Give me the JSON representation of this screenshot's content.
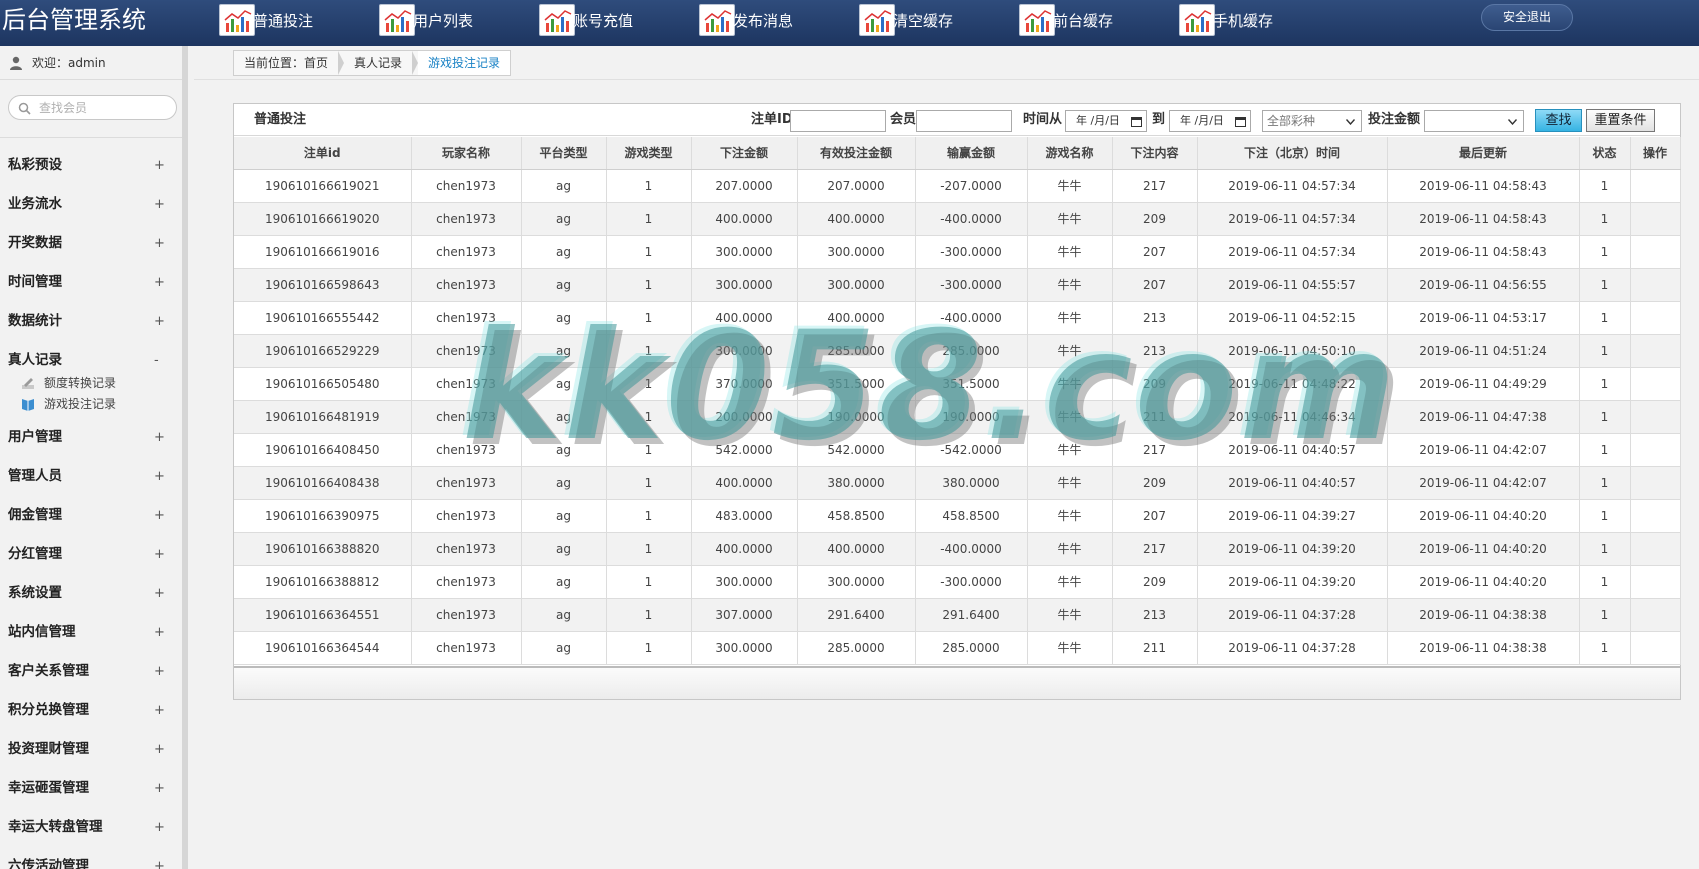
{
  "app": {
    "title": "后台管理系统",
    "logout_label": "安全退出"
  },
  "topnav": [
    {
      "label": "普通投注"
    },
    {
      "label": "用户列表"
    },
    {
      "label": "账号充值"
    },
    {
      "label": "发布消息"
    },
    {
      "label": "清空缓存"
    },
    {
      "label": "前台缓存"
    },
    {
      "label": "手机缓存"
    }
  ],
  "sidebar": {
    "welcome": "欢迎：admin",
    "search_placeholder": "查找会员",
    "menu": [
      {
        "label": "私彩预设",
        "toggle": "+"
      },
      {
        "label": "业务流水",
        "toggle": "+"
      },
      {
        "label": "开奖数据",
        "toggle": "+"
      },
      {
        "label": "时间管理",
        "toggle": "+"
      },
      {
        "label": "数据统计",
        "toggle": "+"
      },
      {
        "label": "真人记录",
        "toggle": "-"
      },
      {
        "label": "用户管理",
        "toggle": "+"
      },
      {
        "label": "管理人员",
        "toggle": "+"
      },
      {
        "label": "佣金管理",
        "toggle": "+"
      },
      {
        "label": "分红管理",
        "toggle": "+"
      },
      {
        "label": "系统设置",
        "toggle": "+"
      },
      {
        "label": "站内信管理",
        "toggle": "+"
      },
      {
        "label": "客户关系管理",
        "toggle": "+"
      },
      {
        "label": "积分兑换管理",
        "toggle": "+"
      },
      {
        "label": "投资理财管理",
        "toggle": "+"
      },
      {
        "label": "幸运砸蛋管理",
        "toggle": "+"
      },
      {
        "label": "幸运大转盘管理",
        "toggle": "+"
      },
      {
        "label": "六传活动管理",
        "toggle": "+"
      }
    ],
    "submenu": [
      {
        "label": "额度转换记录"
      },
      {
        "label": "游戏投注记录"
      }
    ]
  },
  "breadcrumb": [
    {
      "label": "当前位置：首页"
    },
    {
      "label": "真人记录"
    },
    {
      "label": "游戏投注记录"
    }
  ],
  "panel": {
    "title": "普通投注"
  },
  "filters": {
    "order_id_label": "注单ID",
    "member_label": "会员",
    "time_from_label": "时间从",
    "time_to_label": "到",
    "date_from": "年 /月/日",
    "date_to": "年 /月/日",
    "lottery_select": "全部彩种",
    "amount_label": "投注金额",
    "amount_select": "",
    "search_button": "查找",
    "reset_button": "重置条件"
  },
  "table": {
    "headers": [
      "注单id",
      "玩家名称",
      "平台类型",
      "游戏类型",
      "下注金额",
      "有效投注金额",
      "输赢金额",
      "游戏名称",
      "下注内容",
      "下注（北京）时间",
      "最后更新",
      "状态",
      "操作"
    ],
    "rows": [
      [
        "190610166619021",
        "chen1973",
        "ag",
        "1",
        "207.0000",
        "207.0000",
        "-207.0000",
        "牛牛",
        "217",
        "2019-06-11 04:57:34",
        "2019-06-11 04:58:43",
        "1",
        ""
      ],
      [
        "190610166619020",
        "chen1973",
        "ag",
        "1",
        "400.0000",
        "400.0000",
        "-400.0000",
        "牛牛",
        "209",
        "2019-06-11 04:57:34",
        "2019-06-11 04:58:43",
        "1",
        ""
      ],
      [
        "190610166619016",
        "chen1973",
        "ag",
        "1",
        "300.0000",
        "300.0000",
        "-300.0000",
        "牛牛",
        "207",
        "2019-06-11 04:57:34",
        "2019-06-11 04:58:43",
        "1",
        ""
      ],
      [
        "190610166598643",
        "chen1973",
        "ag",
        "1",
        "300.0000",
        "300.0000",
        "-300.0000",
        "牛牛",
        "207",
        "2019-06-11 04:55:57",
        "2019-06-11 04:56:55",
        "1",
        ""
      ],
      [
        "190610166555442",
        "chen1973",
        "ag",
        "1",
        "400.0000",
        "400.0000",
        "-400.0000",
        "牛牛",
        "213",
        "2019-06-11 04:52:15",
        "2019-06-11 04:53:17",
        "1",
        ""
      ],
      [
        "190610166529229",
        "chen1973",
        "ag",
        "1",
        "300.0000",
        "285.0000",
        "285.0000",
        "牛牛",
        "213",
        "2019-06-11 04:50:10",
        "2019-06-11 04:51:24",
        "1",
        ""
      ],
      [
        "190610166505480",
        "chen1973",
        "ag",
        "1",
        "370.0000",
        "351.5000",
        "351.5000",
        "牛牛",
        "209",
        "2019-06-11 04:48:22",
        "2019-06-11 04:49:29",
        "1",
        ""
      ],
      [
        "190610166481919",
        "chen1973",
        "ag",
        "1",
        "200.0000",
        "190.0000",
        "190.0000",
        "牛牛",
        "211",
        "2019-06-11 04:46:34",
        "2019-06-11 04:47:38",
        "1",
        ""
      ],
      [
        "190610166408450",
        "chen1973",
        "ag",
        "1",
        "542.0000",
        "542.0000",
        "-542.0000",
        "牛牛",
        "217",
        "2019-06-11 04:40:57",
        "2019-06-11 04:42:07",
        "1",
        ""
      ],
      [
        "190610166408438",
        "chen1973",
        "ag",
        "1",
        "400.0000",
        "380.0000",
        "380.0000",
        "牛牛",
        "209",
        "2019-06-11 04:40:57",
        "2019-06-11 04:42:07",
        "1",
        ""
      ],
      [
        "190610166390975",
        "chen1973",
        "ag",
        "1",
        "483.0000",
        "458.8500",
        "458.8500",
        "牛牛",
        "207",
        "2019-06-11 04:39:27",
        "2019-06-11 04:40:20",
        "1",
        ""
      ],
      [
        "190610166388820",
        "chen1973",
        "ag",
        "1",
        "400.0000",
        "400.0000",
        "-400.0000",
        "牛牛",
        "217",
        "2019-06-11 04:39:20",
        "2019-06-11 04:40:20",
        "1",
        ""
      ],
      [
        "190610166388812",
        "chen1973",
        "ag",
        "1",
        "300.0000",
        "300.0000",
        "-300.0000",
        "牛牛",
        "209",
        "2019-06-11 04:39:20",
        "2019-06-11 04:40:20",
        "1",
        ""
      ],
      [
        "190610166364551",
        "chen1973",
        "ag",
        "1",
        "307.0000",
        "291.6400",
        "291.6400",
        "牛牛",
        "213",
        "2019-06-11 04:37:28",
        "2019-06-11 04:38:38",
        "1",
        ""
      ],
      [
        "190610166364544",
        "chen1973",
        "ag",
        "1",
        "300.0000",
        "285.0000",
        "285.0000",
        "牛牛",
        "211",
        "2019-06-11 04:37:28",
        "2019-06-11 04:38:38",
        "1",
        ""
      ]
    ]
  },
  "watermark": "kk058.com"
}
